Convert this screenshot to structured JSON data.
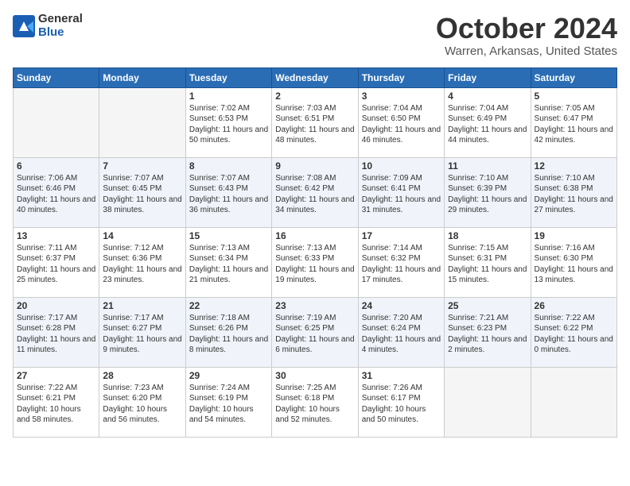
{
  "logo": {
    "general": "General",
    "blue": "Blue"
  },
  "title": "October 2024",
  "location": "Warren, Arkansas, United States",
  "days_header": [
    "Sunday",
    "Monday",
    "Tuesday",
    "Wednesday",
    "Thursday",
    "Friday",
    "Saturday"
  ],
  "weeks": [
    [
      {
        "num": "",
        "content": ""
      },
      {
        "num": "",
        "content": ""
      },
      {
        "num": "1",
        "content": "Sunrise: 7:02 AM\nSunset: 6:53 PM\nDaylight: 11 hours and 50 minutes."
      },
      {
        "num": "2",
        "content": "Sunrise: 7:03 AM\nSunset: 6:51 PM\nDaylight: 11 hours and 48 minutes."
      },
      {
        "num": "3",
        "content": "Sunrise: 7:04 AM\nSunset: 6:50 PM\nDaylight: 11 hours and 46 minutes."
      },
      {
        "num": "4",
        "content": "Sunrise: 7:04 AM\nSunset: 6:49 PM\nDaylight: 11 hours and 44 minutes."
      },
      {
        "num": "5",
        "content": "Sunrise: 7:05 AM\nSunset: 6:47 PM\nDaylight: 11 hours and 42 minutes."
      }
    ],
    [
      {
        "num": "6",
        "content": "Sunrise: 7:06 AM\nSunset: 6:46 PM\nDaylight: 11 hours and 40 minutes."
      },
      {
        "num": "7",
        "content": "Sunrise: 7:07 AM\nSunset: 6:45 PM\nDaylight: 11 hours and 38 minutes."
      },
      {
        "num": "8",
        "content": "Sunrise: 7:07 AM\nSunset: 6:43 PM\nDaylight: 11 hours and 36 minutes."
      },
      {
        "num": "9",
        "content": "Sunrise: 7:08 AM\nSunset: 6:42 PM\nDaylight: 11 hours and 34 minutes."
      },
      {
        "num": "10",
        "content": "Sunrise: 7:09 AM\nSunset: 6:41 PM\nDaylight: 11 hours and 31 minutes."
      },
      {
        "num": "11",
        "content": "Sunrise: 7:10 AM\nSunset: 6:39 PM\nDaylight: 11 hours and 29 minutes."
      },
      {
        "num": "12",
        "content": "Sunrise: 7:10 AM\nSunset: 6:38 PM\nDaylight: 11 hours and 27 minutes."
      }
    ],
    [
      {
        "num": "13",
        "content": "Sunrise: 7:11 AM\nSunset: 6:37 PM\nDaylight: 11 hours and 25 minutes."
      },
      {
        "num": "14",
        "content": "Sunrise: 7:12 AM\nSunset: 6:36 PM\nDaylight: 11 hours and 23 minutes."
      },
      {
        "num": "15",
        "content": "Sunrise: 7:13 AM\nSunset: 6:34 PM\nDaylight: 11 hours and 21 minutes."
      },
      {
        "num": "16",
        "content": "Sunrise: 7:13 AM\nSunset: 6:33 PM\nDaylight: 11 hours and 19 minutes."
      },
      {
        "num": "17",
        "content": "Sunrise: 7:14 AM\nSunset: 6:32 PM\nDaylight: 11 hours and 17 minutes."
      },
      {
        "num": "18",
        "content": "Sunrise: 7:15 AM\nSunset: 6:31 PM\nDaylight: 11 hours and 15 minutes."
      },
      {
        "num": "19",
        "content": "Sunrise: 7:16 AM\nSunset: 6:30 PM\nDaylight: 11 hours and 13 minutes."
      }
    ],
    [
      {
        "num": "20",
        "content": "Sunrise: 7:17 AM\nSunset: 6:28 PM\nDaylight: 11 hours and 11 minutes."
      },
      {
        "num": "21",
        "content": "Sunrise: 7:17 AM\nSunset: 6:27 PM\nDaylight: 11 hours and 9 minutes."
      },
      {
        "num": "22",
        "content": "Sunrise: 7:18 AM\nSunset: 6:26 PM\nDaylight: 11 hours and 8 minutes."
      },
      {
        "num": "23",
        "content": "Sunrise: 7:19 AM\nSunset: 6:25 PM\nDaylight: 11 hours and 6 minutes."
      },
      {
        "num": "24",
        "content": "Sunrise: 7:20 AM\nSunset: 6:24 PM\nDaylight: 11 hours and 4 minutes."
      },
      {
        "num": "25",
        "content": "Sunrise: 7:21 AM\nSunset: 6:23 PM\nDaylight: 11 hours and 2 minutes."
      },
      {
        "num": "26",
        "content": "Sunrise: 7:22 AM\nSunset: 6:22 PM\nDaylight: 11 hours and 0 minutes."
      }
    ],
    [
      {
        "num": "27",
        "content": "Sunrise: 7:22 AM\nSunset: 6:21 PM\nDaylight: 10 hours and 58 minutes."
      },
      {
        "num": "28",
        "content": "Sunrise: 7:23 AM\nSunset: 6:20 PM\nDaylight: 10 hours and 56 minutes."
      },
      {
        "num": "29",
        "content": "Sunrise: 7:24 AM\nSunset: 6:19 PM\nDaylight: 10 hours and 54 minutes."
      },
      {
        "num": "30",
        "content": "Sunrise: 7:25 AM\nSunset: 6:18 PM\nDaylight: 10 hours and 52 minutes."
      },
      {
        "num": "31",
        "content": "Sunrise: 7:26 AM\nSunset: 6:17 PM\nDaylight: 10 hours and 50 minutes."
      },
      {
        "num": "",
        "content": ""
      },
      {
        "num": "",
        "content": ""
      }
    ]
  ]
}
